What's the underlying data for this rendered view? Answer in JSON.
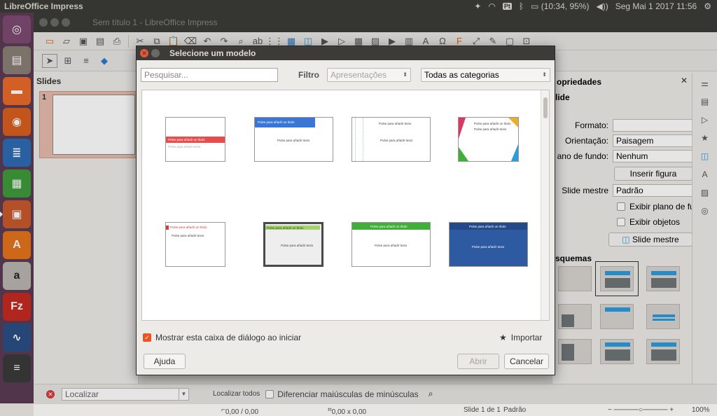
{
  "topbar": {
    "app_title": "LibreOffice Impress",
    "battery": "(10:34, 95%)",
    "datetime": "Seg Mai  1 2017 11:56",
    "keyboard": "Pt"
  },
  "window": {
    "title": "Sem título 1 - LibreOffice Impress"
  },
  "slides_pane": {
    "header": "Slides",
    "slide_number": "1"
  },
  "properties": {
    "header": "opriedades",
    "section": "lide",
    "format_label": "Formato:",
    "format_value": "",
    "orientation_label": "Orientação:",
    "orientation_value": "Paisagem",
    "background_label": "ano de fundo:",
    "background_value": "Nenhum",
    "insert_image": "Inserir figura",
    "master_label": "Slide mestre",
    "master_value": "Padrão",
    "show_background": "Exibir plano de fu",
    "show_objects": "Exibir objetos",
    "master_button": "Slide mestre",
    "layouts_header": "squemas"
  },
  "find_bar": {
    "placeholder": "Localizar",
    "find_all": "Localizar todos",
    "match_case": "Diferenciar maiúsculas de minúsculas"
  },
  "status_bar": {
    "position": "0,00 / 0,00",
    "size": "0,00 x 0,00",
    "slide": "Slide 1 de 1",
    "master": "Padrão",
    "zoom": "100%"
  },
  "dialog": {
    "title": "Selecione um modelo",
    "search_placeholder": "Pesquisar...",
    "filter_label": "Filtro",
    "filter_type": "Apresentações",
    "filter_category": "Todas as categorias",
    "show_on_start": "Mostrar esta caixa de diálogo ao iniciar",
    "import": "Importar",
    "help": "Ajuda",
    "open": "Abrir",
    "cancel": "Cancelar",
    "templates": [
      {
        "title": "Pulse para añadir un título",
        "sub": "Pulse para añadir texto",
        "accent": "#e84c4c"
      },
      {
        "title": "Pulse para añadir un título",
        "sub": "Pulse para añadir texto",
        "accent": "#3b76d4"
      },
      {
        "title": "Pulse para añadir texto",
        "sub": "Pulse para añadir texto",
        "accent": "#9fc6e0"
      },
      {
        "title": "Pulse para añadir un título",
        "sub": "Pulse para añadir texto",
        "accent": "#e8b02a"
      },
      {
        "title": "Pulse para añadir un título",
        "sub": "Pulse para añadir texto",
        "accent": "#d63a3a"
      },
      {
        "title": "Pulse para añadir un título",
        "sub": "Pulse para añadir texto",
        "accent": "#a3d36a"
      },
      {
        "title": "Pulse para añadir un título",
        "sub": "Pulse para añadir texto",
        "accent": "#3fae3a"
      },
      {
        "title": "Pulse para añadir un título",
        "sub": "Pulse para añadir texto",
        "accent": "#2d5aa0"
      }
    ]
  },
  "launcher_icons": [
    "ubuntu-icon",
    "files-icon",
    "folder-icon",
    "firefox-icon",
    "writer-icon",
    "calc-icon",
    "impress-icon",
    "software-center-icon",
    "amazon-icon",
    "filezilla-icon",
    "system-monitor-icon",
    "stack-icon"
  ]
}
